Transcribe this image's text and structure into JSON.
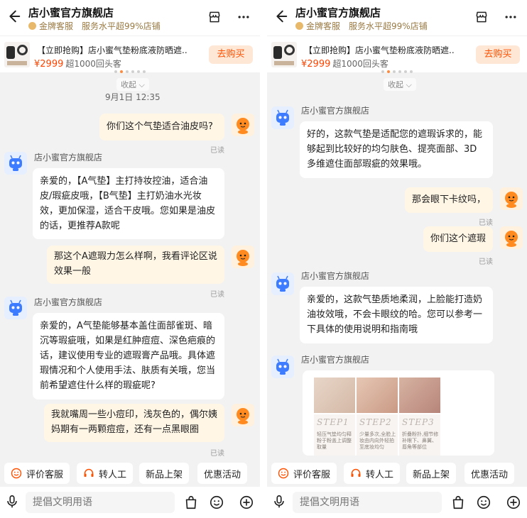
{
  "header": {
    "shop_name": "店小蜜官方旗舰店",
    "badge": "金牌客服",
    "service_level": "服务水平超99%店铺"
  },
  "promo": {
    "title": "【立即抢购】店小蜜气垫粉底液防晒遮...",
    "price": "¥2999",
    "note": "超1000回头客",
    "buy_label": "去购买"
  },
  "collapse_label": "收起 ⌵",
  "left": {
    "timestamp": "9月1日 12:35",
    "read_label": "已读",
    "sender_name": "店小蜜官方旗舰店",
    "messages": {
      "m1": "你们这个气垫适合油皮吗?",
      "m2": "亲爱的，【A气垫】主打持妆控油，适合油皮/瑕疵皮哦，【B气垫】主打奶油水光妆效，更加保湿，适合干皮哦。您如果是油皮的话，更推荐A款呢",
      "m3": "那这个A遮瑕力怎么样啊，我看评论区说效果一般",
      "m4": "亲爱的，A气垫能够基本盖住面部雀斑、暗沉等瑕疵哦，如果是红肿痘痘、深色疤痕的话，建议使用专业的遮瑕膏产品哦。具体遮瑕情况和个人使用手法、肤质有关哦，您当前希望遮住什么样的瑕疵呢?",
      "m5": "我就嘴周一些小痘印，浅灰色的，偶尔姨妈期有一两颗痘痘，还有一点黑眼圈"
    }
  },
  "right": {
    "read_label": "已读",
    "sender_name": "店小蜜官方旗舰店",
    "messages": {
      "m1": "好的，这款气垫是适配您的遮瑕诉求的，能够起到比较好的均匀肤色、提亮面部、3D多维遮住面部瑕疵的效果哦。",
      "m2": "那会眼下卡纹吗，",
      "m3": "你们这个遮瑕",
      "m4": "亲爱的，这款气垫质地柔润，上脸能打造奶油妆效哦，不会卡眼纹的哈。您可以参考一下具体的使用说明和指南哦"
    },
    "image_steps": [
      {
        "label": "STEP1",
        "desc": "轻压气垫均匀释粉于粉盖上调整取量"
      },
      {
        "label": "STEP2",
        "desc": "少量多次,全脸上妆由内向外轻拍至底妆均匀"
      },
      {
        "label": "STEP3",
        "desc": "折叠粉扑,细节修补眼下、鼻翼、唇角等部位"
      }
    ]
  },
  "quick_actions": [
    "评价客服",
    "转人工",
    "新品上架",
    "优惠活动"
  ],
  "input": {
    "placeholder": "提倡文明用语"
  },
  "colors": {
    "accent": "#ff5000",
    "price": "#ff4400",
    "outgoing_bubble": "#fff6e6",
    "incoming_bubble": "#ffffff",
    "background": "#f2f2f2"
  },
  "icons": [
    "back-arrow-icon",
    "crown-icon",
    "store-icon",
    "more-icon",
    "smile-icon",
    "headset-icon",
    "mic-icon",
    "bag-icon",
    "emoji-icon",
    "plus-icon",
    "chevron-down-icon"
  ]
}
